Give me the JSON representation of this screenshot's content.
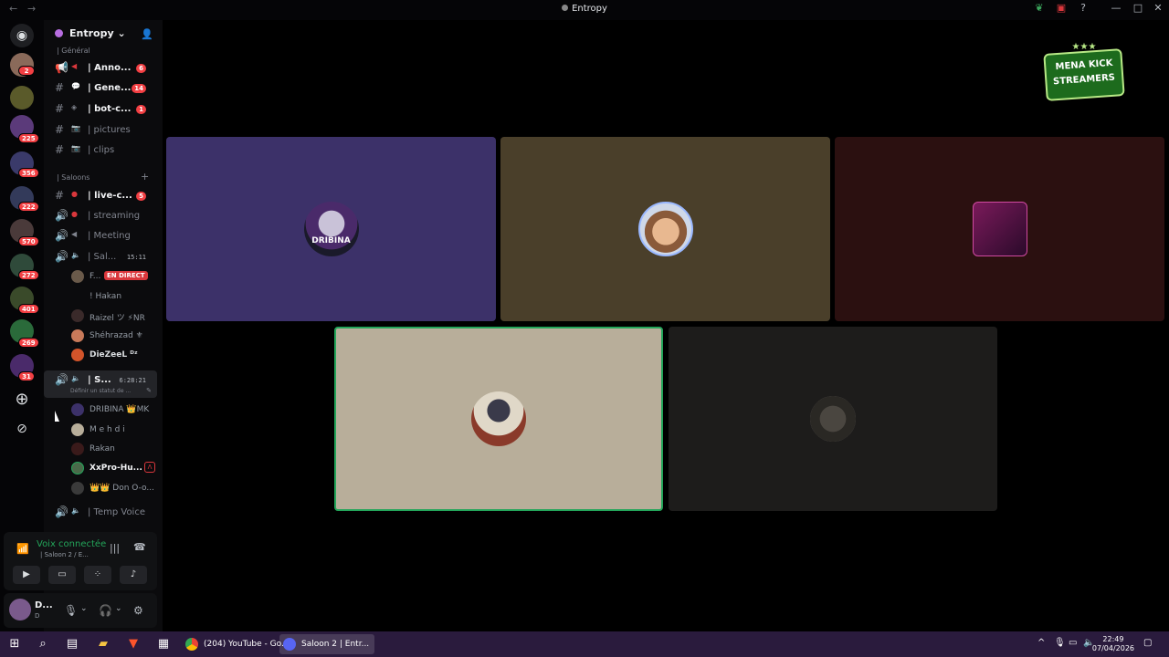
{
  "window": {
    "title": "Entropy",
    "back_icon": "arrow-left-icon",
    "forward_icon": "arrow-right-icon"
  },
  "servers": {
    "badges": [
      "2",
      "225",
      "356",
      "222",
      "570",
      "272",
      "401",
      "269",
      "31"
    ]
  },
  "guild": {
    "name": "Entropy",
    "chevron": "chevron-down-icon"
  },
  "categories": {
    "general": "| Général",
    "saloons": "| Saloons"
  },
  "channels": [
    {
      "name": "| Anno...",
      "type": "announcement",
      "badge": "6",
      "unread": true
    },
    {
      "name": "| Gene...",
      "type": "text",
      "badge": "14",
      "unread": true
    },
    {
      "name": "| bot-c...",
      "type": "text",
      "badge": "1",
      "unread": true
    },
    {
      "name": "| pictures",
      "type": "text",
      "badge": "",
      "unread": false
    },
    {
      "name": "| clips",
      "type": "text",
      "badge": "",
      "unread": false
    },
    {
      "name": "| live-c...",
      "type": "text",
      "badge": "5",
      "unread": true
    },
    {
      "name": "| streaming",
      "type": "voice",
      "badge": "",
      "unread": false
    },
    {
      "name": "| Meeting",
      "type": "voice",
      "badge": "",
      "unread": false
    },
    {
      "name": "| Sal...",
      "type": "voice",
      "time": "15:11",
      "unread": false
    },
    {
      "name": "| S...",
      "type": "voice",
      "time": "6:28:21",
      "status": "Définir un statut de ...",
      "unread": true
    },
    {
      "name": "| Temp Voice",
      "type": "voice",
      "badge": "",
      "unread": false
    }
  ],
  "voice_users_1": [
    {
      "name": "F...",
      "live": "EN DIRECT"
    },
    {
      "name": "! Hakan"
    },
    {
      "name": "Raizel ツ ⚡NR"
    },
    {
      "name": "Shéhrazad ⚜"
    },
    {
      "name": "DieZeeL ᴰᶻ"
    }
  ],
  "voice_users_2": [
    {
      "name": "DRIBINA 👑MK"
    },
    {
      "name": "M e h d i"
    },
    {
      "name": "Rakan"
    },
    {
      "name": "XxPro-Hu..."
    },
    {
      "name": "👑👑 Don O-o..."
    }
  ],
  "voice_panel": {
    "title": "Voix connectée",
    "subtitle": "| Saloon 2 / E..."
  },
  "user_bar": {
    "name": "D...",
    "status": "D"
  },
  "stage": {
    "logo_line1": "MENA KICK",
    "logo_line2": "STREAMERS",
    "tiles": [
      {
        "name": "DRIBINA",
        "color": "#3c3169"
      },
      {
        "name": "tile-2",
        "color": "#4a3f2a"
      },
      {
        "name": "tile-3",
        "color": "#2b1010"
      },
      {
        "name": "tile-4",
        "color": "#b8ae9a",
        "speaking": true
      },
      {
        "name": "tile-5",
        "color": "#1d1c1b"
      }
    ]
  },
  "taskbar": {
    "apps": [
      {
        "label": "(204) YouTube - Go...",
        "icon": "chrome-icon"
      },
      {
        "label": "Saloon 2 | Entr...",
        "icon": "discord-icon",
        "active": true
      }
    ],
    "time": "22:49",
    "date": "07/04/2026"
  },
  "colors": {
    "accent_green": "#23a55a",
    "badge_red": "#f23f43",
    "taskbar": "#2a1b3d"
  }
}
